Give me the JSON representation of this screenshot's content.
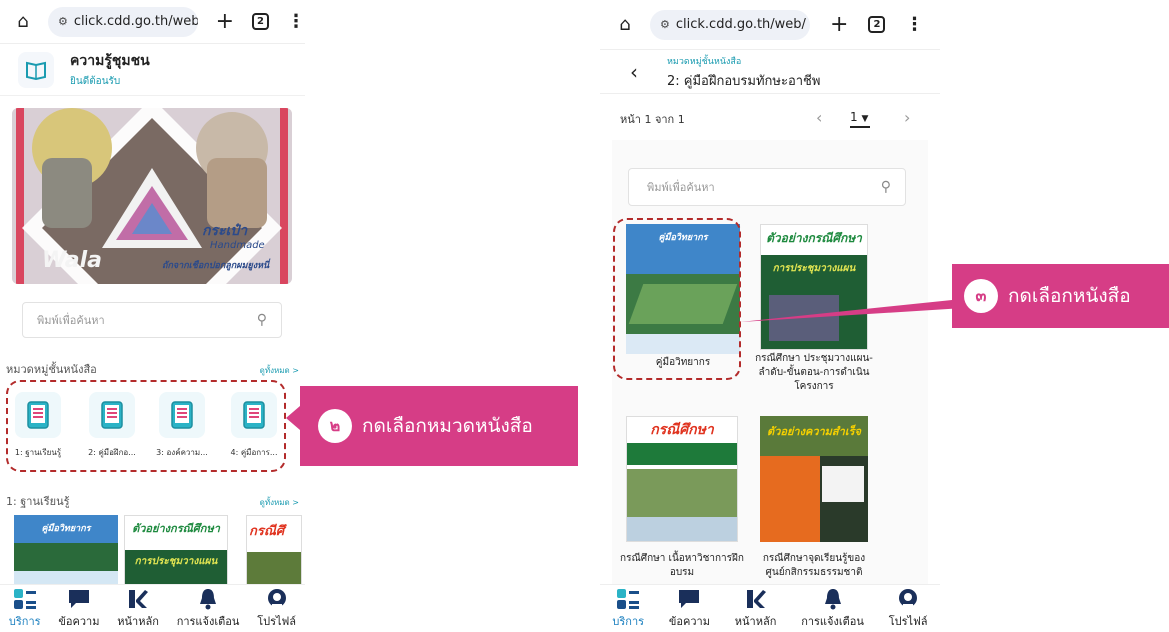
{
  "browser": {
    "url": "click.cdd.go.th/web/",
    "tab_count": "2"
  },
  "left": {
    "app_title": "ความรู้ชุมชน",
    "app_subtitle": "ยินดีต้อนรับ",
    "banner": {
      "brand": "Wala",
      "title": "กระเป๋า",
      "script": "Handmade",
      "caption": "ถักจากเชือกปอกลูกผมยูงหนี่"
    },
    "search_placeholder": "พิมพ์เพื่อค้นหา",
    "categories_section": {
      "title": "หมวดหมู่ชั้นหนังสือ",
      "more": "ดูทั้งหมด >"
    },
    "categories": [
      {
        "label": "1: ฐานเรียนรู้"
      },
      {
        "label": "2: คู่มือฝึกอ..."
      },
      {
        "label": "3: องค์ความ..."
      },
      {
        "label": "4: คู่มือการ..."
      }
    ],
    "books_section": {
      "title": "1: ฐานเรียนรู้",
      "more": "ดูทั้งหมด >"
    },
    "books_preview": [
      {
        "title": "คู่มือวิทยากร"
      },
      {
        "title": "ตัวอย่างกรณีศึกษา",
        "subtitle": "การประชุมวางแผน"
      },
      {
        "title": "กรณีศึ"
      }
    ]
  },
  "callout_2": {
    "number": "๒",
    "text": "กดเลือกหมวดหนังสือ"
  },
  "callout_3": {
    "number": "๓",
    "text": "กดเลือกหนังสือ"
  },
  "right": {
    "breadcrumb": "หมวดหมู่ชั้นหนังสือ",
    "title": "2: คู่มือฝึกอบรมทักษะอาชีพ",
    "pager": {
      "info": "หน้า 1 จาก 1",
      "current": "1"
    },
    "search_placeholder": "พิมพ์เพื่อค้นหา",
    "books": [
      {
        "caption": "คู่มือวิทยากร",
        "cover_title": "คู่มือวิทยากร"
      },
      {
        "caption": "กรณีศึกษา ประชุมวางแผน-ลำดับ-ขั้นตอน-การดำเนินโครงการ",
        "cover_title": "ตัวอย่างกรณีศึกษา",
        "cover_sub": "การประชุมวางแผน"
      },
      {
        "caption": "กรณีศึกษา เนื้อหาวิชาการฝึกอบรม",
        "cover_title": "กรณีศึกษา"
      },
      {
        "caption": "กรณีศึกษาจุดเรียนรู้ของศูนย์กสิกรรมธรรมชาติ",
        "cover_title": "ตัวอย่างความสำเร็จ"
      }
    ]
  },
  "nav": [
    {
      "label": "บริการ",
      "icon": "grid-icon",
      "active": true
    },
    {
      "label": "ข้อความ",
      "icon": "message-icon"
    },
    {
      "label": "หน้าหลัก",
      "icon": "home-logo-icon"
    },
    {
      "label": "การแจ้งเตือน",
      "icon": "bell-icon"
    },
    {
      "label": "โปรไฟล์",
      "icon": "profile-icon"
    }
  ],
  "colors": {
    "accent": "#d63d86",
    "teal": "#1a9bb0",
    "nav_active": "#1a7fbf",
    "dash": "#b32b2b"
  }
}
